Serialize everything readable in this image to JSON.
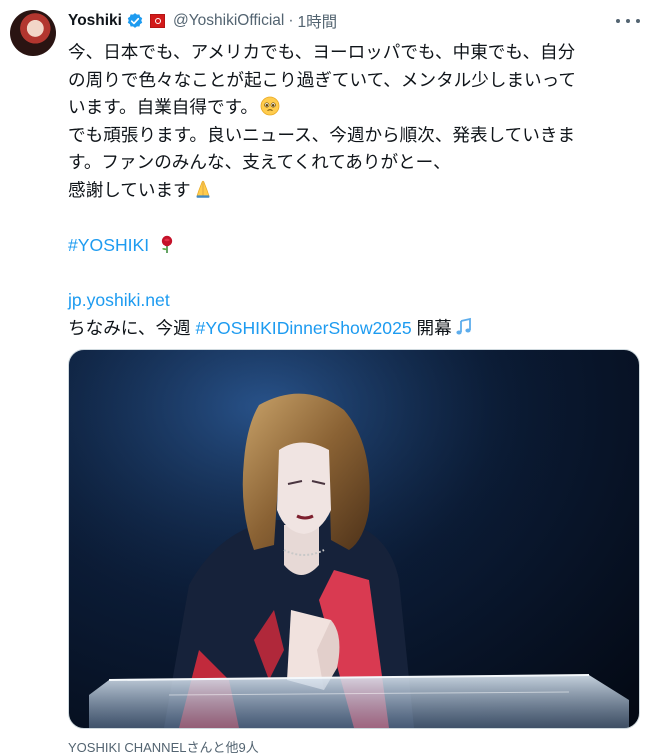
{
  "author": {
    "name": "Yoshiki",
    "handle": "@YoshikiOfficial",
    "separator": "·",
    "time": "1時間"
  },
  "tweet": {
    "line1": "今、日本でも、アメリカでも、ヨーロッパでも、中東でも、自分",
    "line2": "の周りで色々なことが起こり過ぎていて、メンタル少しまいって",
    "line3": "います。自業自得です。",
    "line4": "でも頑張ります。良いニュース、今週から順次、発表していきま",
    "line5": "す。ファンのみんな、支えてくれてありがとー、",
    "line6": "感謝しています",
    "hashtag": "#YOSHIKI",
    "url": "jp.yoshiki.net",
    "line_prefix": "ちなみに、今週 ",
    "hashtag2": "#YOSHIKIDinnerShow2025",
    "line_suffix": " 開幕"
  },
  "media": {
    "caption": "YOSHIKI CHANNELさんと他9人"
  },
  "icons": {
    "verified": "verified-badge-icon",
    "affiliation": "affiliation-badge-icon",
    "more": "more-options-icon",
    "pleading": "pleading-face-emoji",
    "pray": "folded-hands-emoji",
    "rose": "rose-emoji",
    "notes": "music-notes-emoji"
  },
  "colors": {
    "link": "#1d9bf0",
    "secondary_text": "#536471",
    "text": "#0f1419"
  }
}
